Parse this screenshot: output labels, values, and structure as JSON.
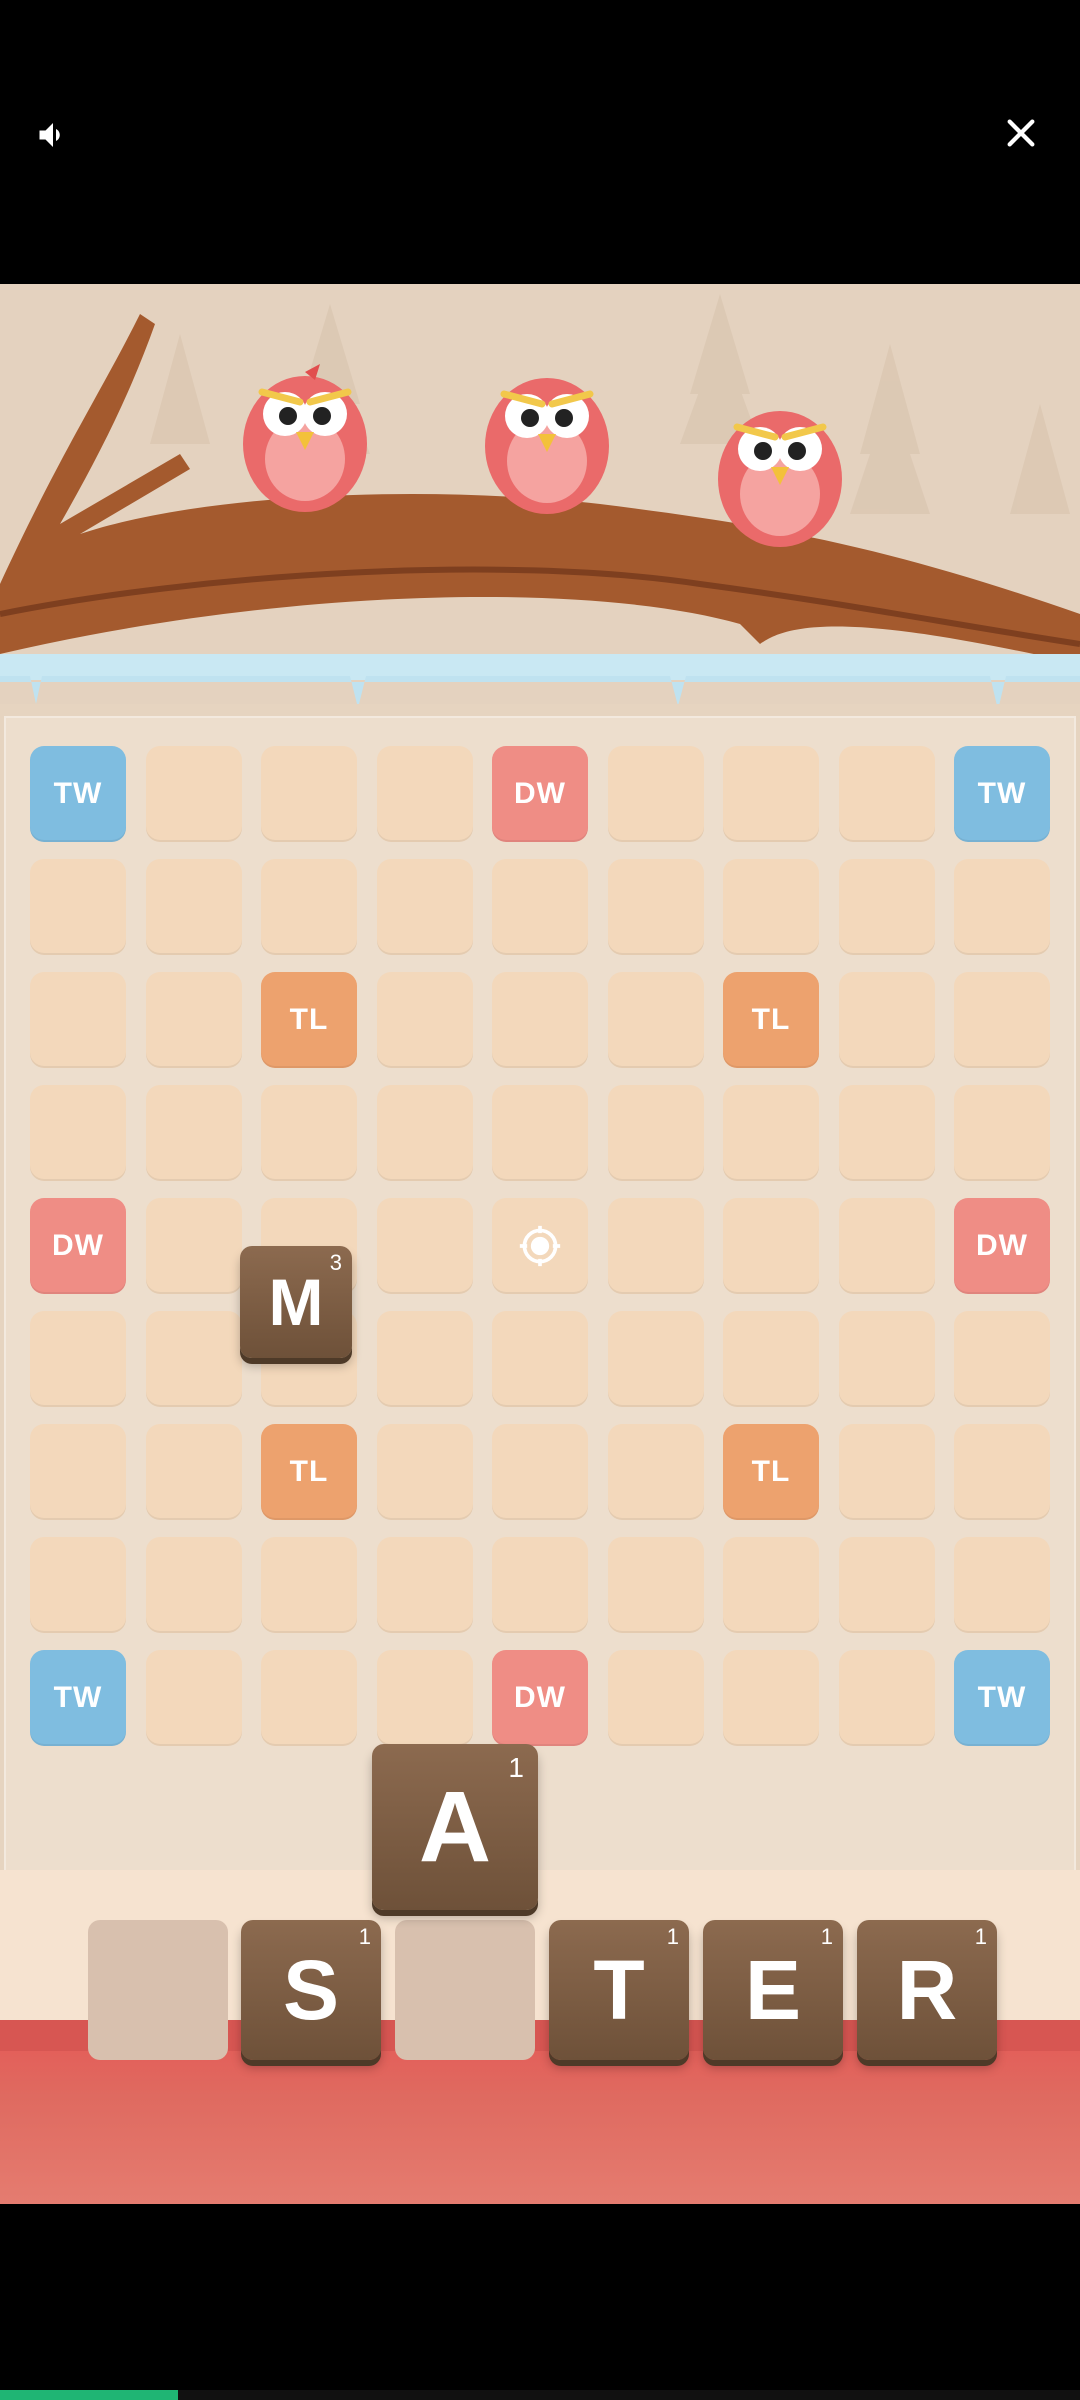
{
  "top_bar": {
    "sound_icon": "speaker-icon",
    "close_icon": "close-icon"
  },
  "board": {
    "rows": [
      [
        "TW",
        "",
        "",
        "",
        "DW",
        "",
        "",
        "",
        "TW"
      ],
      [
        "",
        "",
        "",
        "",
        "",
        "",
        "",
        "",
        ""
      ],
      [
        "",
        "",
        "TL",
        "",
        "",
        "",
        "TL",
        "",
        ""
      ],
      [
        "",
        "",
        "",
        "",
        "",
        "",
        "",
        "",
        ""
      ],
      [
        "DW",
        "",
        "",
        "",
        "CENTER",
        "",
        "",
        "",
        "DW"
      ],
      [
        "",
        "",
        "",
        "",
        "",
        "",
        "",
        "",
        ""
      ],
      [
        "",
        "",
        "TL",
        "",
        "",
        "",
        "TL",
        "",
        ""
      ],
      [
        "",
        "",
        "",
        "",
        "",
        "",
        "",
        "",
        ""
      ],
      [
        "TW",
        "",
        "",
        "",
        "DW",
        "",
        "",
        "",
        "TW"
      ]
    ],
    "center_icon": "target-icon"
  },
  "placed_tile": {
    "letter": "M",
    "points": "3"
  },
  "dragged_tile": {
    "letter": "A",
    "points": "1"
  },
  "rack": [
    {
      "letter": "",
      "points": ""
    },
    {
      "letter": "S",
      "points": "1"
    },
    {
      "letter": "",
      "points": ""
    },
    {
      "letter": "T",
      "points": "1"
    },
    {
      "letter": "E",
      "points": "1"
    },
    {
      "letter": "R",
      "points": "1"
    }
  ],
  "video_progress": 0.165,
  "colors": {
    "tw": "#7fbde0",
    "dw": "#ef8d85",
    "tl": "#eda26e",
    "cell": "#f3d8bb",
    "tile": "#7a5a40",
    "progress": "#1fb574"
  }
}
